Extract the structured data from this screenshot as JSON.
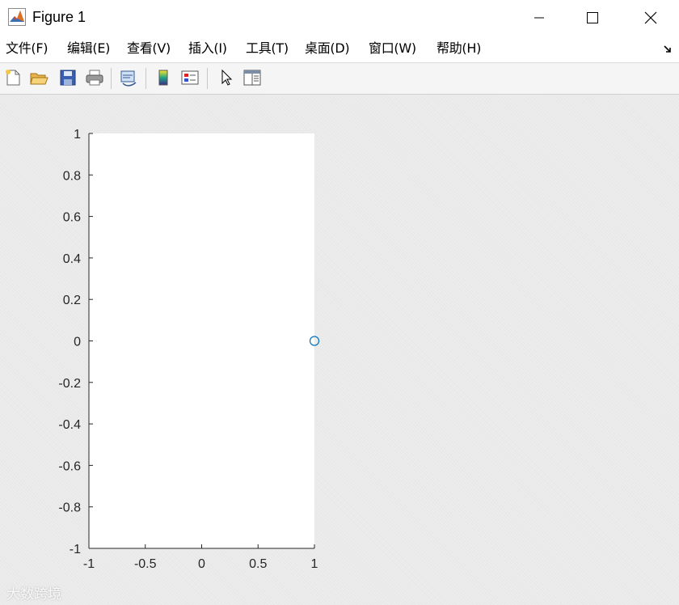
{
  "window": {
    "title": "Figure 1",
    "icon": "matlab-logo-icon"
  },
  "menu": {
    "items": [
      {
        "label": "文件(F)"
      },
      {
        "label": "编辑(E)"
      },
      {
        "label": "查看(V)"
      },
      {
        "label": "插入(I)"
      },
      {
        "label": "工具(T)"
      },
      {
        "label": "桌面(D)"
      },
      {
        "label": "窗口(W)"
      },
      {
        "label": "帮助(H)"
      }
    ]
  },
  "toolbar": {
    "buttons": [
      "new-figure-icon",
      "open-file-icon",
      "save-icon",
      "print-icon",
      "link-figure-icon",
      "insert-colorbar-icon",
      "insert-legend-icon",
      "edit-plot-cursor-icon",
      "property-inspector-icon"
    ]
  },
  "chart_data": {
    "type": "scatter",
    "title": "",
    "xlabel": "",
    "ylabel": "",
    "xlim": [
      -1,
      1
    ],
    "ylim": [
      -1,
      1
    ],
    "xticks": [
      "-1",
      "-0.5",
      "0",
      "0.5",
      "1"
    ],
    "yticks": [
      "1",
      "0.8",
      "0.6",
      "0.4",
      "0.2",
      "0",
      "-0.2",
      "-0.4",
      "-0.6",
      "-0.8",
      "-1"
    ],
    "grid": false,
    "marker": "circle",
    "marker_color": "#0072BD",
    "series": [
      {
        "x": [
          1
        ],
        "y": [
          0
        ]
      }
    ]
  },
  "watermark": {
    "text": "大数跨境"
  }
}
